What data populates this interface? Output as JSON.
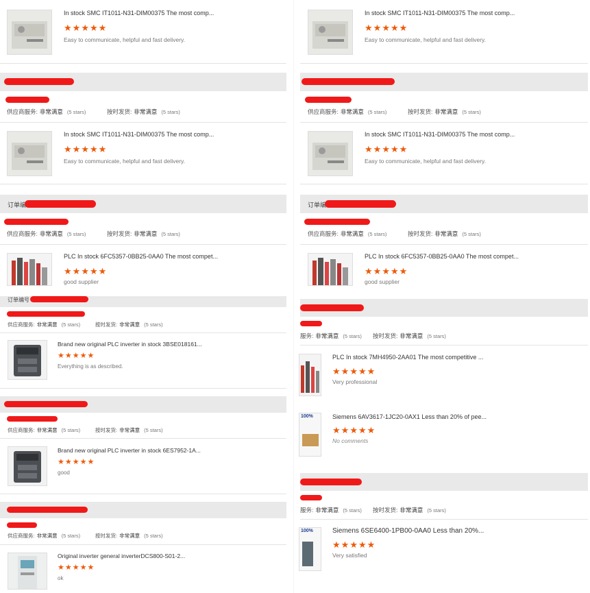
{
  "products": {
    "smc": "In stock SMC IT1011-N31-DIM00375 The most comp...",
    "plc_6fc": "PLC In stock 6FC5357-0BB25-0AA0 The most compet...",
    "inv_3bse": "Brand new original PLC inverter in stock 3BSE018161...",
    "inv_6es": "Brand new original PLC inverter in stock 6ES7952-1A...",
    "inv_dcs": "Original inverter general inverterDCS800-S01-2...",
    "plc_7mh": "PLC In stock 7MH4950-2AA01 The most competitive ...",
    "siemens_6av": "Siemens 6AV3617-1JC20-0AX1 Less than 20% of pee...",
    "siemens_6se": "Siemens 6SE6400-1PB00-0AA0 Less than 20%..."
  },
  "comments": {
    "easy": "Easy to communicate, helpful and fast delivery.",
    "good_supplier": "good supplier",
    "described": "Everything is as described.",
    "good": "good",
    "ok": "ok",
    "very_professional": "Very professional",
    "no_comments": "No comments",
    "very_satisfied": "Very satisfied"
  },
  "ratings": {
    "supplier_service": "供应商服务:",
    "on_time": "按时发货:",
    "supplier_service_partial": "服务:",
    "very_satisfied": "非常满意",
    "five_stars": "(5 stars)"
  },
  "order_label": "订单编号",
  "stars": [
    "★",
    "★",
    "★",
    "★",
    "★"
  ],
  "thumb_badge": "100%",
  "colors": {
    "star": "#ee5a09",
    "redaction": "#f01919",
    "section_bar": "#e9e9e9"
  }
}
